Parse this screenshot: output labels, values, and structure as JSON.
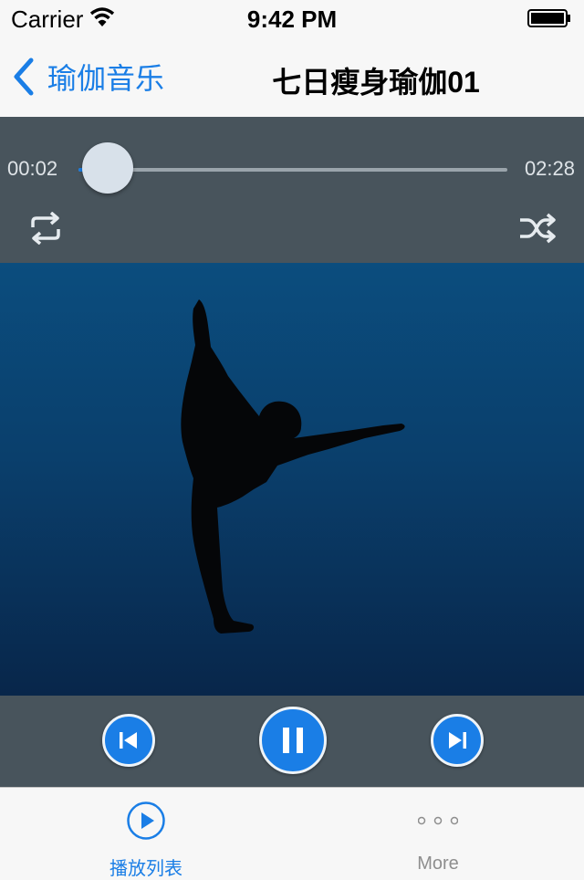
{
  "status_bar": {
    "carrier": "Carrier",
    "time": "9:42 PM"
  },
  "nav": {
    "back_label": "瑜伽音乐",
    "title": "七日瘦身瑜伽01"
  },
  "player": {
    "elapsed": "00:02",
    "duration": "02:28",
    "progress_fraction": 0.014
  },
  "tabs": [
    {
      "label": "播放列表",
      "icon": "play-circle-icon",
      "active": true
    },
    {
      "label": "More",
      "icon": "more-dots-icon",
      "active": false
    }
  ],
  "colors": {
    "accent": "#1a7ee6",
    "panel": "#48545c",
    "artwork_top": "#0b4d7e",
    "artwork_bottom": "#08264a"
  }
}
